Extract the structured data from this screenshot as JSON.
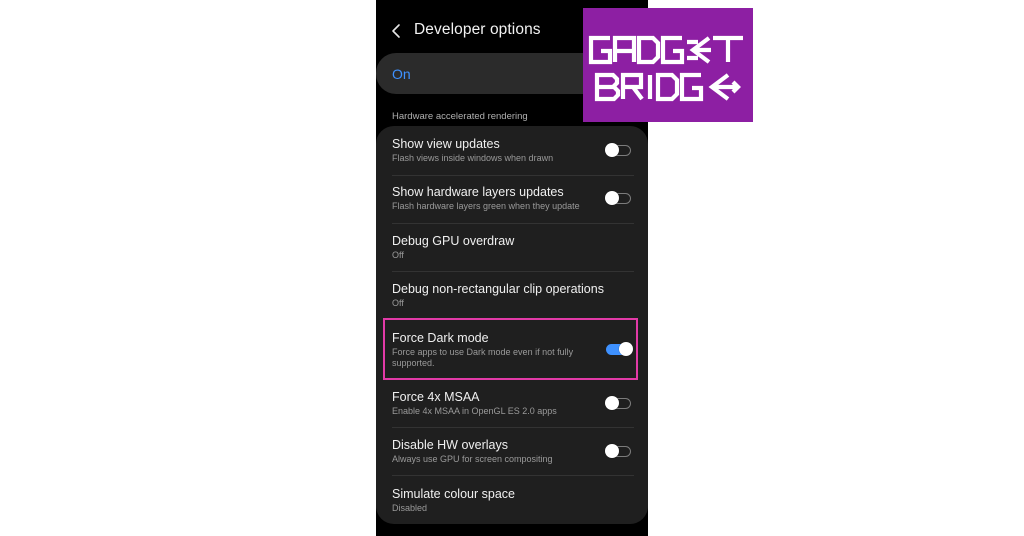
{
  "screen": {
    "title": "Developer options",
    "master_switch": {
      "label": "On"
    },
    "section_header": "Hardware accelerated rendering",
    "items": [
      {
        "title": "Show view updates",
        "subtitle": "Flash views inside windows when drawn",
        "toggle": false
      },
      {
        "title": "Show hardware layers updates",
        "subtitle": "Flash hardware layers green when they update",
        "toggle": false
      },
      {
        "title": "Debug GPU overdraw",
        "subtitle": "Off"
      },
      {
        "title": "Debug non-rectangular clip operations",
        "subtitle": "Off"
      },
      {
        "title": "Force Dark mode",
        "subtitle": "Force apps to use Dark mode even if not fully supported.",
        "toggle": true
      },
      {
        "title": "Force 4x MSAA",
        "subtitle": "Enable 4x MSAA in OpenGL ES 2.0 apps",
        "toggle": false
      },
      {
        "title": "Disable HW overlays",
        "subtitle": "Always use GPU for screen compositing",
        "toggle": false
      },
      {
        "title": "Simulate colour space",
        "subtitle": "Disabled"
      }
    ]
  },
  "logo": {
    "line1": "GADGET",
    "line2": "BRIDGE",
    "background": "#8d1fa3"
  },
  "colors": {
    "accent": "#3e91ff",
    "highlight_border": "#e23aa7"
  }
}
